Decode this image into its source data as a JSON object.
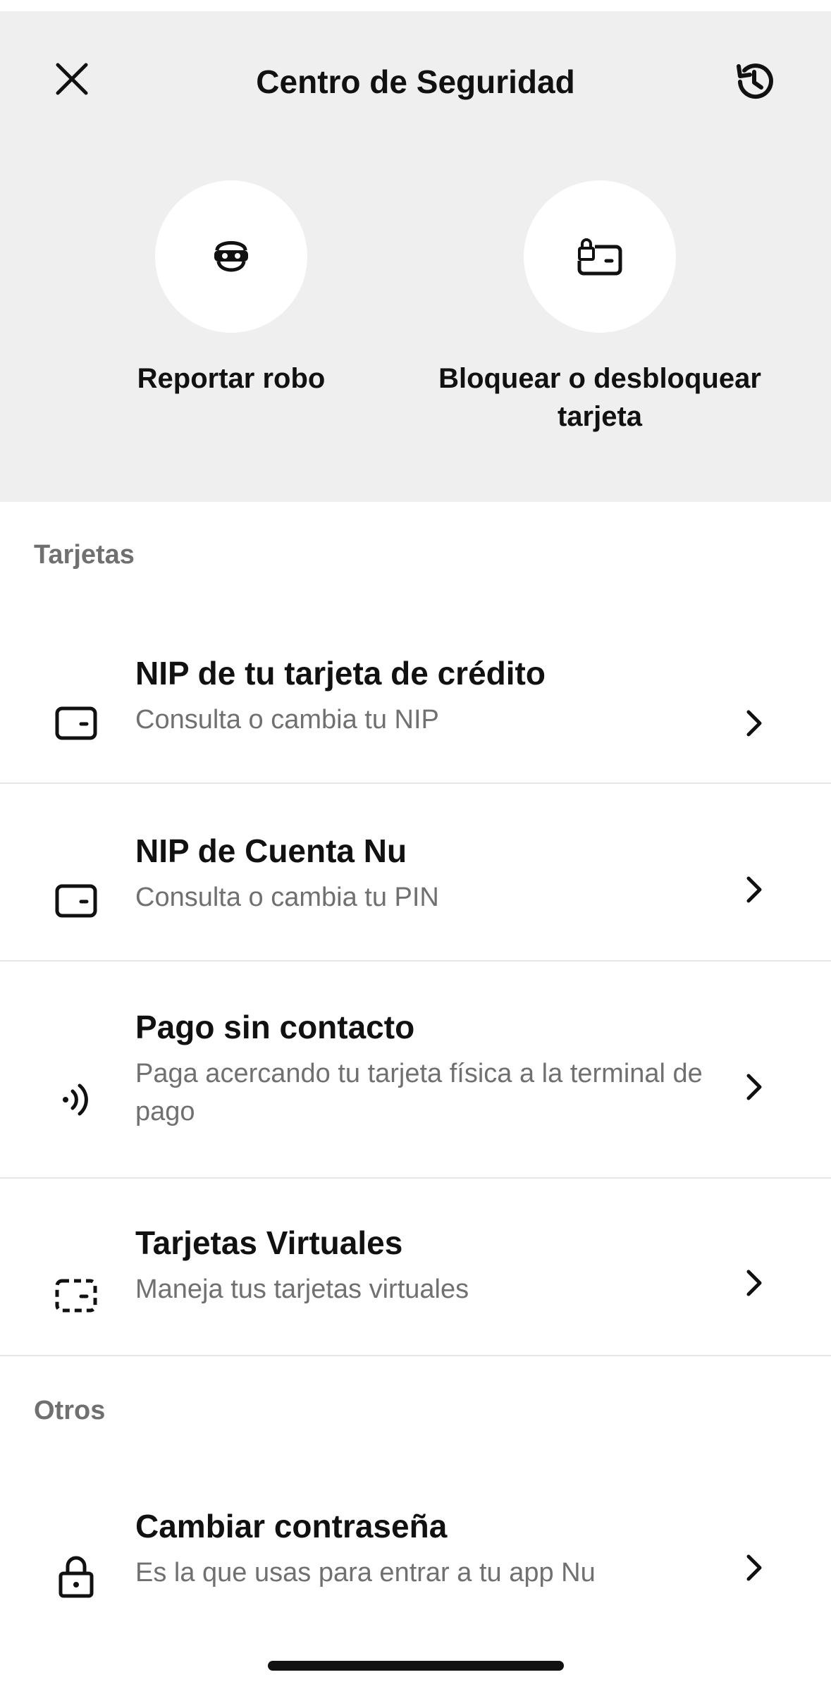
{
  "header": {
    "title": "Centro de Seguridad",
    "close_icon": "close-icon",
    "history_icon": "history-icon"
  },
  "quick_actions": [
    {
      "label": "Reportar robo",
      "icon": "thief-mask-icon"
    },
    {
      "label": "Bloquear o desbloquear tarjeta",
      "icon": "card-lock-icon"
    }
  ],
  "sections": [
    {
      "title": "Tarjetas",
      "items": [
        {
          "title": "NIP de tu tarjeta de crédito",
          "subtitle": "Consulta o cambia tu NIP",
          "icon": "card-icon"
        },
        {
          "title": "NIP de Cuenta Nu",
          "subtitle": "Consulta o cambia tu PIN",
          "icon": "card-icon"
        },
        {
          "title": "Pago sin contacto",
          "subtitle": "Paga acercando tu tarjeta física a la terminal de pago",
          "icon": "contactless-icon"
        },
        {
          "title": "Tarjetas Virtuales",
          "subtitle": "Maneja tus tarjetas virtuales",
          "icon": "virtual-card-icon"
        }
      ]
    },
    {
      "title": "Otros",
      "items": [
        {
          "title": "Cambiar contraseña",
          "subtitle": "Es la que usas para entrar a tu app Nu",
          "icon": "lock-icon"
        }
      ]
    }
  ],
  "colors": {
    "header_bg": "#efefef",
    "text_primary": "#111111",
    "text_secondary": "#707070",
    "divider": "#e6e6e6"
  }
}
